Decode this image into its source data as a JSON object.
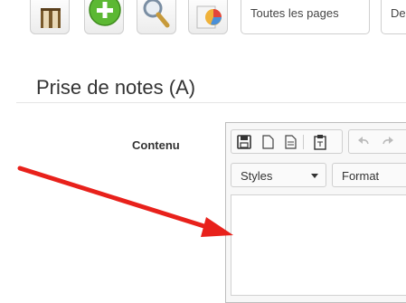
{
  "toolbar": {
    "buttons": [
      {
        "icon": "book-icon"
      },
      {
        "icon": "add-icon"
      },
      {
        "icon": "search-icon"
      },
      {
        "icon": "stats-icon"
      }
    ],
    "all_pages_label": "Toutes les pages",
    "next_label": "De"
  },
  "page": {
    "title": "Prise de notes (A)"
  },
  "form": {
    "content_label": "Contenu"
  },
  "editor": {
    "toolbar_icons": [
      "save-icon",
      "new-document-icon",
      "template-icon",
      "paste-text-icon",
      "undo-icon",
      "redo-icon"
    ],
    "styles_label": "Styles",
    "format_label": "Format"
  },
  "annotation": {
    "arrow_color": "#e8211b"
  },
  "colors": {
    "green": "#5cb833",
    "border": "#cfcfcf"
  }
}
